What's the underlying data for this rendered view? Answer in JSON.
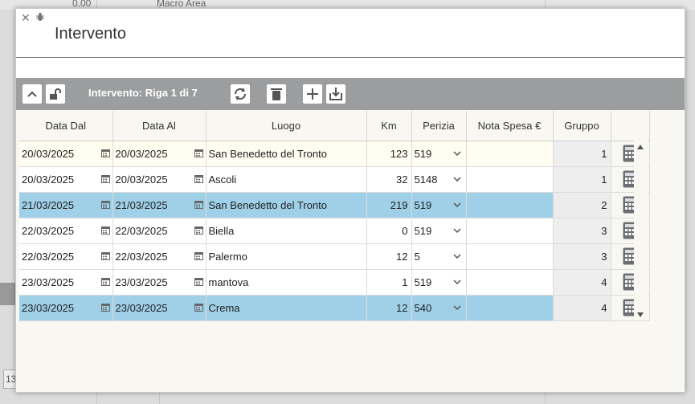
{
  "background": {
    "value_text": "0.00",
    "area_text": "Macro Area",
    "corner_text": "13"
  },
  "modal": {
    "title": "Intervento"
  },
  "toolbar": {
    "record_label": "Intervento: Riga 1 di 7"
  },
  "grid": {
    "columns": [
      "Data Dal",
      "Data Al",
      "Luogo",
      "Km",
      "Perizia",
      "Nota Spesa €",
      "Gruppo"
    ],
    "rows": [
      {
        "data_dal": "20/03/2025",
        "data_al": "20/03/2025",
        "luogo": "San Benedetto del Tronto",
        "km": "123",
        "perizia": "519",
        "nota": "",
        "gruppo": "1"
      },
      {
        "data_dal": "20/03/2025",
        "data_al": "20/03/2025",
        "luogo": "Ascoli",
        "km": "32",
        "perizia": "5148",
        "nota": "",
        "gruppo": "1"
      },
      {
        "data_dal": "21/03/2025",
        "data_al": "21/03/2025",
        "luogo": "San Benedetto del Tronto",
        "km": "219",
        "perizia": "519",
        "nota": "",
        "gruppo": "2"
      },
      {
        "data_dal": "22/03/2025",
        "data_al": "22/03/2025",
        "luogo": "Biella",
        "km": "0",
        "perizia": "519",
        "nota": "",
        "gruppo": "3"
      },
      {
        "data_dal": "22/03/2025",
        "data_al": "22/03/2025",
        "luogo": "Palermo",
        "km": "12",
        "perizia": "5",
        "nota": "",
        "gruppo": "3"
      },
      {
        "data_dal": "23/03/2025",
        "data_al": "23/03/2025",
        "luogo": "mantova",
        "km": "1",
        "perizia": "519",
        "nota": "",
        "gruppo": "4"
      },
      {
        "data_dal": "23/03/2025",
        "data_al": "23/03/2025",
        "luogo": "Crema",
        "km": "12",
        "perizia": "540",
        "nota": "",
        "gruppo": "4"
      }
    ]
  },
  "colors": {
    "toolbar_bg": "#9b9d9f",
    "selected_row": "#9fd0e8",
    "current_row": "#fffdf0"
  }
}
